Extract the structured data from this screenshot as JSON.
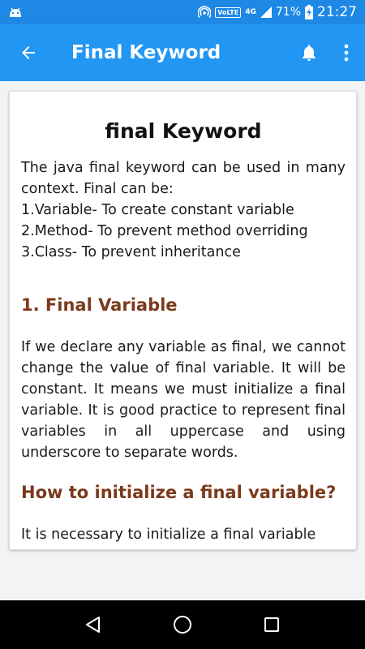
{
  "status_bar": {
    "volte": "VoLTE",
    "network": "4G",
    "battery": "71%",
    "time": "21:27",
    "icons": [
      "android-icon",
      "hotspot-icon",
      "signal-icon",
      "battery-charging-icon"
    ]
  },
  "app_bar": {
    "title": "Final Keyword",
    "icons": [
      "back-arrow-icon",
      "bell-icon",
      "more-vert-icon"
    ]
  },
  "article": {
    "title": "final Keyword",
    "intro": "The java final keyword can be used in many context. Final can be:",
    "list": [
      "1.Variable- To create constant variable",
      "2.Method- To prevent method overriding",
      "3.Class- To prevent inheritance"
    ],
    "section1_heading": "1. Final Variable",
    "section1_text": "If we declare any variable as final, we cannot change the value of final variable. It will be constant. It means we must initialize a final variable. It is good practice to represent final variables in all uppercase and using underscore to separate words.",
    "section2_heading": "How to initialize a final variable?",
    "section2_text": "It is necessary to initialize a final variable"
  },
  "nav_bar": {
    "icons": [
      "back-triangle-icon",
      "home-circle-icon",
      "recents-square-icon"
    ]
  },
  "colors": {
    "status_bar": "#1e88e5",
    "app_bar": "#2196f3",
    "heading": "#7b3a1c"
  }
}
